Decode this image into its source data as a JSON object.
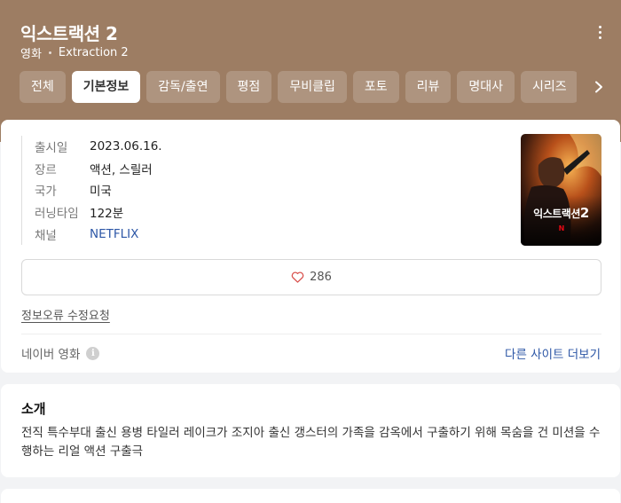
{
  "header": {
    "title": "익스트랙션 2",
    "category": "영화",
    "original_title": "Extraction 2",
    "background_color": "#9d7d63"
  },
  "tabs": [
    {
      "label": "전체",
      "active": false
    },
    {
      "label": "기본정보",
      "active": true
    },
    {
      "label": "감독/출연",
      "active": false
    },
    {
      "label": "평점",
      "active": false
    },
    {
      "label": "무비클립",
      "active": false
    },
    {
      "label": "포토",
      "active": false
    },
    {
      "label": "리뷰",
      "active": false
    },
    {
      "label": "명대사",
      "active": false
    },
    {
      "label": "시리즈",
      "active": false
    }
  ],
  "info": {
    "rows": [
      {
        "label": "출시일",
        "value": "2023.06.16."
      },
      {
        "label": "장르",
        "value": "액션, 스릴러"
      },
      {
        "label": "국가",
        "value": "미국"
      },
      {
        "label": "러닝타임",
        "value": "122분"
      },
      {
        "label": "채널",
        "value": "NETFLIX"
      }
    ],
    "poster": {
      "title_text": "익스트랙션",
      "title_number": "2",
      "badge": "N"
    },
    "like_count": "286",
    "report_label": "정보오류 수정요청",
    "source_label": "네이버 영화",
    "more_sites_label": "다른 사이트 더보기",
    "link_color": "#2c56a6"
  },
  "intro": {
    "title": "소개",
    "text": "전직 특수부대 출신 용병 타일러 레이크가 조지아 출신 갱스터의 가족을 감옥에서 구출하기 위해 목숨을 건 미션을 수행하는 리얼 액션 구출극"
  },
  "icons": [
    "more-vertical-icon",
    "chevron-right-icon",
    "heart-icon",
    "info-icon"
  ]
}
